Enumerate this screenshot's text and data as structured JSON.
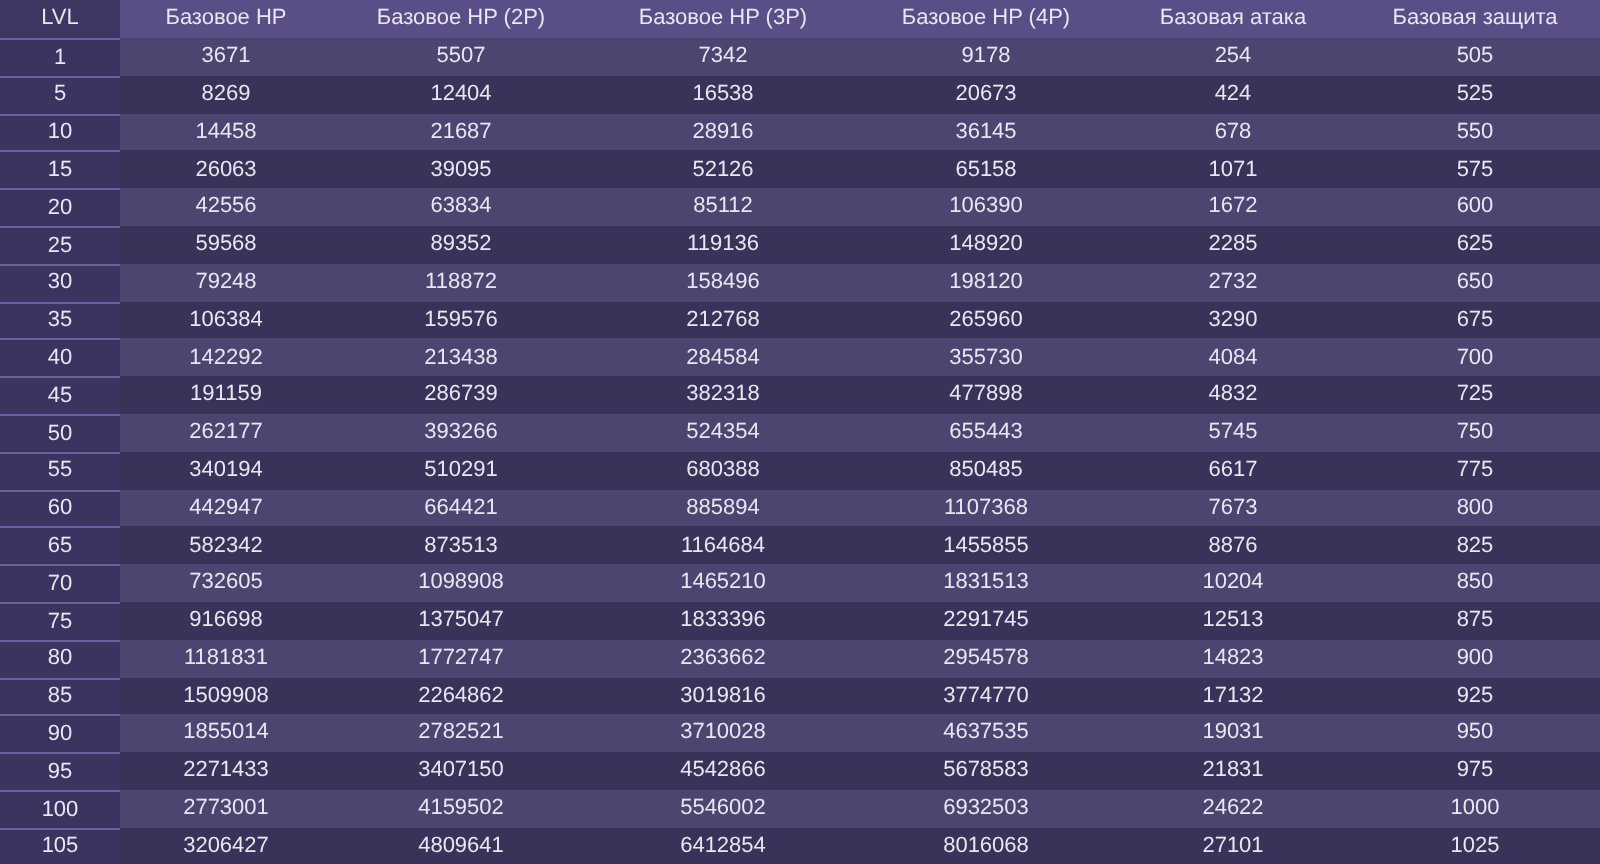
{
  "table": {
    "columns": [
      "LVL",
      "Базовое HP",
      "Базовое HP (2P)",
      "Базовое HP (3P)",
      "Базовое HP (4P)",
      "Базовая атака",
      "Базовая защита"
    ],
    "rows": [
      [
        "1",
        "3671",
        "5507",
        "7342",
        "9178",
        "254",
        "505"
      ],
      [
        "5",
        "8269",
        "12404",
        "16538",
        "20673",
        "424",
        "525"
      ],
      [
        "10",
        "14458",
        "21687",
        "28916",
        "36145",
        "678",
        "550"
      ],
      [
        "15",
        "26063",
        "39095",
        "52126",
        "65158",
        "1071",
        "575"
      ],
      [
        "20",
        "42556",
        "63834",
        "85112",
        "106390",
        "1672",
        "600"
      ],
      [
        "25",
        "59568",
        "89352",
        "119136",
        "148920",
        "2285",
        "625"
      ],
      [
        "30",
        "79248",
        "118872",
        "158496",
        "198120",
        "2732",
        "650"
      ],
      [
        "35",
        "106384",
        "159576",
        "212768",
        "265960",
        "3290",
        "675"
      ],
      [
        "40",
        "142292",
        "213438",
        "284584",
        "355730",
        "4084",
        "700"
      ],
      [
        "45",
        "191159",
        "286739",
        "382318",
        "477898",
        "4832",
        "725"
      ],
      [
        "50",
        "262177",
        "393266",
        "524354",
        "655443",
        "5745",
        "750"
      ],
      [
        "55",
        "340194",
        "510291",
        "680388",
        "850485",
        "6617",
        "775"
      ],
      [
        "60",
        "442947",
        "664421",
        "885894",
        "1107368",
        "7673",
        "800"
      ],
      [
        "65",
        "582342",
        "873513",
        "1164684",
        "1455855",
        "8876",
        "825"
      ],
      [
        "70",
        "732605",
        "1098908",
        "1465210",
        "1831513",
        "10204",
        "850"
      ],
      [
        "75",
        "916698",
        "1375047",
        "1833396",
        "2291745",
        "12513",
        "875"
      ],
      [
        "80",
        "1181831",
        "1772747",
        "2363662",
        "2954578",
        "14823",
        "900"
      ],
      [
        "85",
        "1509908",
        "2264862",
        "3019816",
        "3774770",
        "17132",
        "925"
      ],
      [
        "90",
        "1855014",
        "2782521",
        "3710028",
        "4637535",
        "19031",
        "950"
      ],
      [
        "95",
        "2271433",
        "3407150",
        "4542866",
        "5678583",
        "21831",
        "975"
      ],
      [
        "100",
        "2773001",
        "4159502",
        "5546002",
        "6932503",
        "24622",
        "1000"
      ],
      [
        "105",
        "3206427",
        "4809641",
        "6412854",
        "8016068",
        "27101",
        "1025"
      ]
    ]
  }
}
